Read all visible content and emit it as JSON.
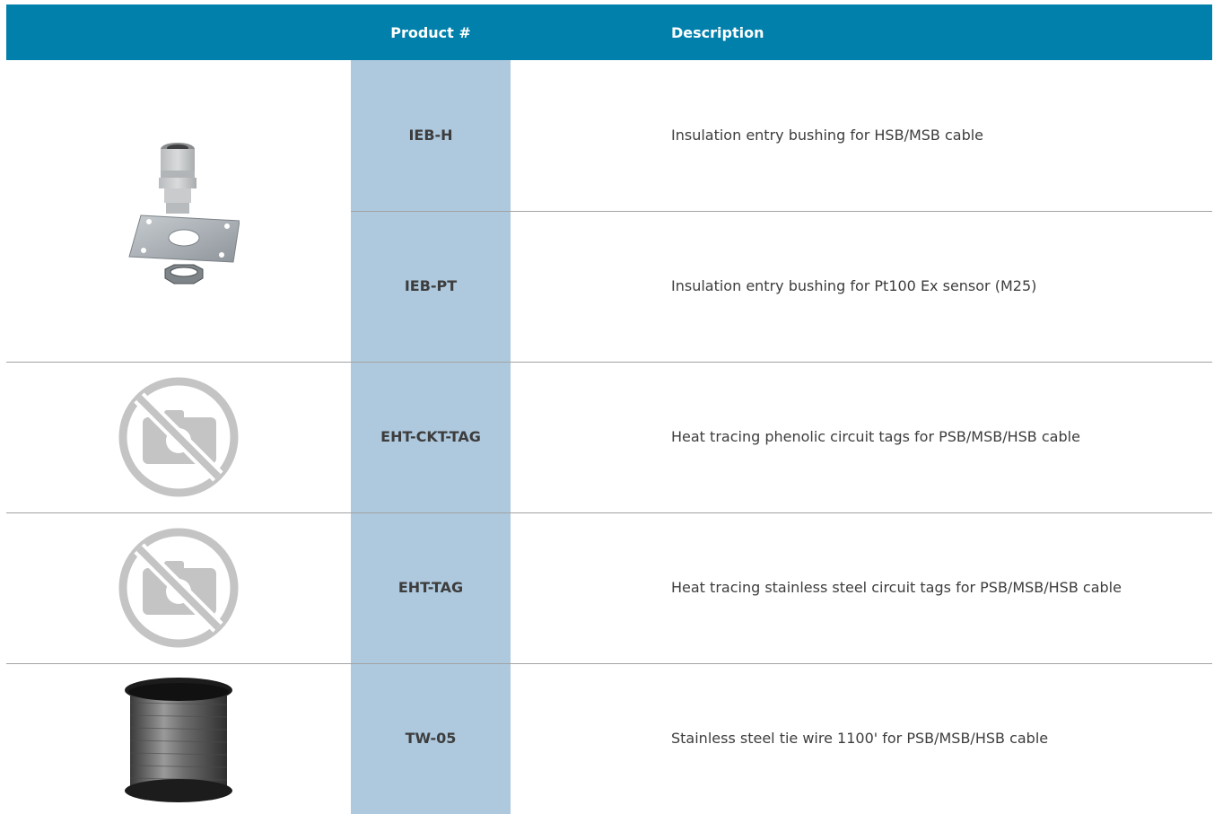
{
  "header": {
    "product_label": "Product #",
    "description_label": "Description"
  },
  "rows": [
    {
      "code": "IEB-H",
      "description": "Insulation entry bushing for HSB/MSB cable"
    },
    {
      "code": "IEB-PT",
      "description": "Insulation entry bushing for Pt100 Ex sensor (M25)"
    },
    {
      "code": "EHT-CKT-TAG",
      "description": "Heat tracing phenolic circuit tags for PSB/MSB/HSB cable"
    },
    {
      "code": "EHT-TAG",
      "description": "Heat tracing stainless steel circuit tags for PSB/MSB/HSB cable"
    },
    {
      "code": "TW-05",
      "description": "Stainless steel tie wire 1100' for PSB/MSB/HSB cable"
    }
  ],
  "images": {
    "bushing": "cable-gland-bushing-image",
    "no_image_1": "no-camera-icon",
    "no_image_2": "no-camera-icon",
    "wire_spool": "wire-spool-image"
  },
  "colors": {
    "header": "#0080ab",
    "product_column": "#aec9de",
    "text": "#3d3d3d"
  }
}
